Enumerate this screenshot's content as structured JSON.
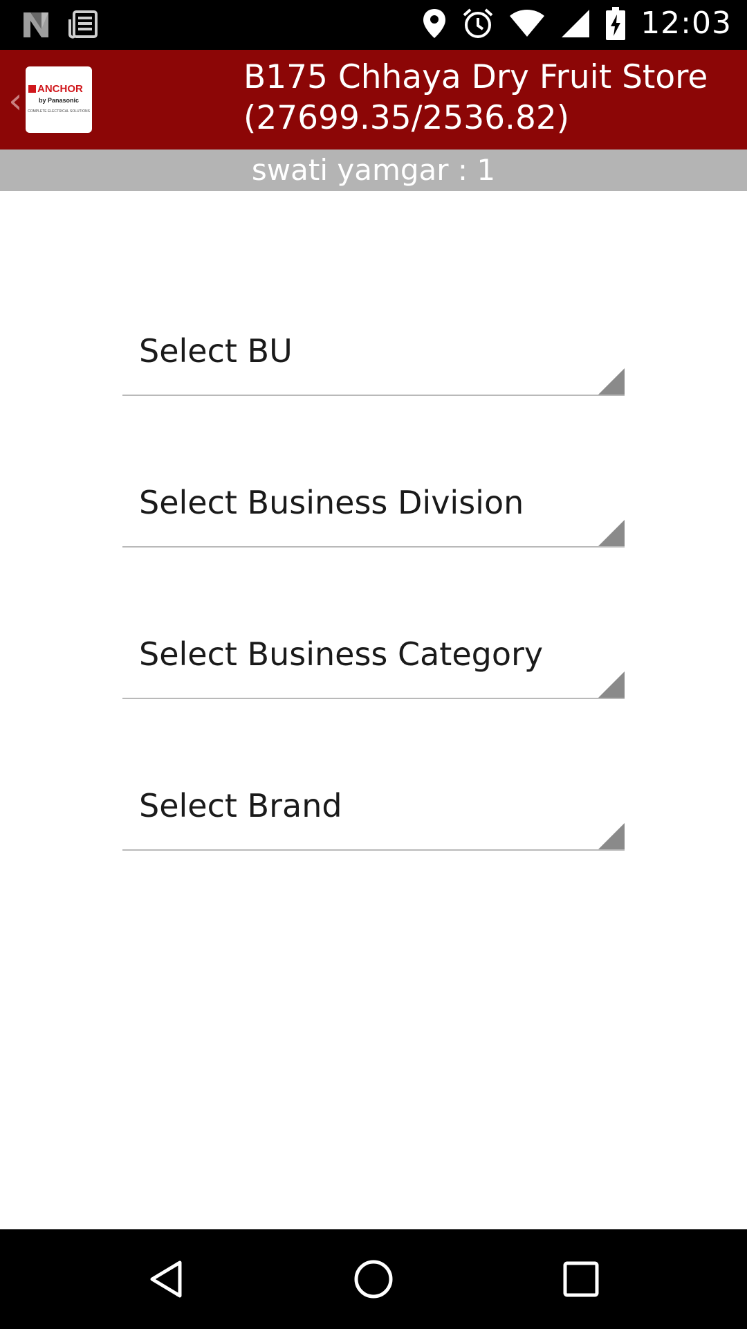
{
  "status_bar": {
    "time": "12:03",
    "left_icons": [
      "n-notification-icon",
      "news-notification-icon"
    ],
    "right_icons": [
      "location-icon",
      "alarm-icon",
      "wifi-icon",
      "signal-icon",
      "battery-charging-icon"
    ]
  },
  "app_bar": {
    "title_line1": "B175 Chhaya Dry Fruit Store",
    "title_line2": "(27699.35/2536.82)",
    "back_icon": "‹",
    "logo": {
      "brand": "ANCHOR",
      "by": "by Panasonic",
      "tagline": "COMPLETE ELECTRICAL SOLUTIONS"
    }
  },
  "subheader": {
    "text": "swati yamgar : 1"
  },
  "form": {
    "spinners": [
      {
        "label": "Select BU"
      },
      {
        "label": "Select Business Division"
      },
      {
        "label": "Select Business Category"
      },
      {
        "label": "Select Brand"
      }
    ]
  },
  "nav_bar": {
    "icons": [
      "back-icon",
      "home-icon",
      "recents-icon"
    ]
  },
  "colors": {
    "app_bar": "#8c0606",
    "subheader": "#b4b4b4",
    "logo_red": "#d0171c"
  }
}
